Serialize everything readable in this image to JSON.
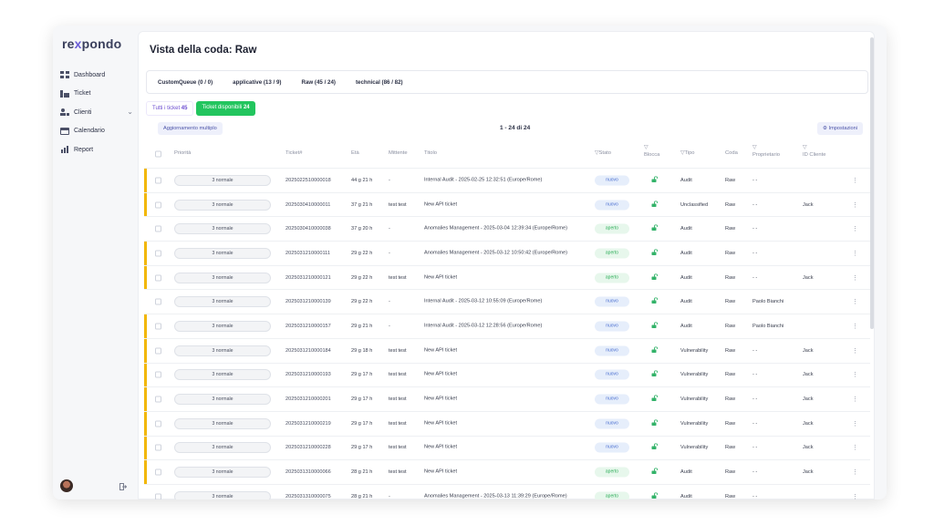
{
  "brand": {
    "name_pre": "re",
    "name_x": "x",
    "name_post": "pondo"
  },
  "sidebar": {
    "items": [
      {
        "label": "Dashboard",
        "icon": "dashboard-icon"
      },
      {
        "label": "Ticket",
        "icon": "ticket-icon"
      },
      {
        "label": "Clienti",
        "icon": "users-icon",
        "chevron": "⌄"
      },
      {
        "label": "Calendario",
        "icon": "calendar-icon"
      },
      {
        "label": "Report",
        "icon": "report-icon"
      }
    ],
    "logout_icon": "logout-icon"
  },
  "page": {
    "title": "Vista della coda: Raw"
  },
  "queue_tabs": [
    "CustomQueue (0 / 0)",
    "applicative (13 / 9)",
    "Raw (45 / 24)",
    "technical (86 / 82)"
  ],
  "filters": {
    "all_label": "Tutti i ticket",
    "all_count": "45",
    "available_label": "Ticket disponibili",
    "available_count": "24"
  },
  "toolbar": {
    "bulk_update": "Aggiornamento multiplo",
    "pagination": "1 - 24 di 24",
    "settings": "Impostazioni"
  },
  "table": {
    "headers": {
      "priorita": "Priorità",
      "ticket": "Ticket#",
      "eta": "Età",
      "mittente": "Mittente",
      "titolo": "Titolo",
      "stato": "Stato",
      "blocca": "Blocca",
      "tipo": "Tipo",
      "coda": "Coda",
      "proprietario": "Proprietario",
      "id_cliente": "ID Cliente"
    },
    "rows": [
      {
        "flag": true,
        "prio": "3 normale",
        "ticket": "2025022510000018",
        "eta": "44 g 21 h",
        "mitt": "-",
        "titolo": "Internal Audit - 2025-02-25 12:32:51 (Europe/Rome)",
        "stato": "nuovo",
        "tipo": "Audit",
        "coda": "Raw",
        "prop": "- -",
        "idc": ""
      },
      {
        "flag": true,
        "prio": "3 normale",
        "ticket": "2025030410000011",
        "eta": "37 g 21 h",
        "mitt": "test test",
        "titolo": "New API ticket",
        "stato": "nuovo",
        "tipo": "Unclassified",
        "coda": "Raw",
        "prop": "- -",
        "idc": "Jack"
      },
      {
        "flag": false,
        "prio": "3 normale",
        "ticket": "2025030410000038",
        "eta": "37 g 20 h",
        "mitt": "-",
        "titolo": "Anomalies Management - 2025-03-04 12:39:34 (Europe/Rome)",
        "stato": "aperto",
        "tipo": "Audit",
        "coda": "Raw",
        "prop": "- -",
        "idc": ""
      },
      {
        "flag": true,
        "prio": "3 normale",
        "ticket": "2025031210000111",
        "eta": "29 g 22 h",
        "mitt": "-",
        "titolo": "Anomalies Management - 2025-03-12 10:50:42 (Europe/Rome)",
        "stato": "aperto",
        "tipo": "Audit",
        "coda": "Raw",
        "prop": "- -",
        "idc": ""
      },
      {
        "flag": true,
        "prio": "3 normale",
        "ticket": "2025031210000121",
        "eta": "29 g 22 h",
        "mitt": "test test",
        "titolo": "New API ticket",
        "stato": "aperto",
        "tipo": "Audit",
        "coda": "Raw",
        "prop": "- -",
        "idc": "Jack"
      },
      {
        "flag": false,
        "prio": "3 normale",
        "ticket": "2025031210000139",
        "eta": "29 g 22 h",
        "mitt": "-",
        "titolo": "Internal Audit - 2025-03-12 10:55:09 (Europe/Rome)",
        "stato": "nuovo",
        "tipo": "Audit",
        "coda": "Raw",
        "prop": "Paolo Bianchi",
        "idc": ""
      },
      {
        "flag": true,
        "prio": "3 normale",
        "ticket": "2025031210000157",
        "eta": "29 g 21 h",
        "mitt": "-",
        "titolo": "Internal Audit - 2025-03-12 12:28:56 (Europe/Rome)",
        "stato": "nuovo",
        "tipo": "Audit",
        "coda": "Raw",
        "prop": "Paolo Bianchi",
        "idc": ""
      },
      {
        "flag": true,
        "prio": "3 normale",
        "ticket": "2025031210000184",
        "eta": "29 g 18 h",
        "mitt": "test test",
        "titolo": "New API ticket",
        "stato": "nuovo",
        "tipo": "Vulnerability",
        "coda": "Raw",
        "prop": "- -",
        "idc": "Jack"
      },
      {
        "flag": true,
        "prio": "3 normale",
        "ticket": "2025031210000193",
        "eta": "29 g 17 h",
        "mitt": "test test",
        "titolo": "New API ticket",
        "stato": "nuovo",
        "tipo": "Vulnerability",
        "coda": "Raw",
        "prop": "- -",
        "idc": "Jack"
      },
      {
        "flag": true,
        "prio": "3 normale",
        "ticket": "2025031210000201",
        "eta": "29 g 17 h",
        "mitt": "test test",
        "titolo": "New API ticket",
        "stato": "nuovo",
        "tipo": "Vulnerability",
        "coda": "Raw",
        "prop": "- -",
        "idc": "Jack"
      },
      {
        "flag": true,
        "prio": "3 normale",
        "ticket": "2025031210000219",
        "eta": "29 g 17 h",
        "mitt": "test test",
        "titolo": "New API ticket",
        "stato": "nuovo",
        "tipo": "Vulnerability",
        "coda": "Raw",
        "prop": "- -",
        "idc": "Jack"
      },
      {
        "flag": true,
        "prio": "3 normale",
        "ticket": "2025031210000228",
        "eta": "29 g 17 h",
        "mitt": "test test",
        "titolo": "New API ticket",
        "stato": "nuovo",
        "tipo": "Vulnerability",
        "coda": "Raw",
        "prop": "- -",
        "idc": "Jack"
      },
      {
        "flag": true,
        "prio": "3 normale",
        "ticket": "2025031310000066",
        "eta": "28 g 21 h",
        "mitt": "test test",
        "titolo": "New API ticket",
        "stato": "aperto",
        "tipo": "Audit",
        "coda": "Raw",
        "prop": "- -",
        "idc": "Jack"
      },
      {
        "flag": false,
        "prio": "3 normale",
        "ticket": "2025031310000075",
        "eta": "28 g 21 h",
        "mitt": "-",
        "titolo": "Anomalies Management - 2025-03-13 11:39:29 (Europe/Rome)",
        "stato": "aperto",
        "tipo": "Audit",
        "coda": "Raw",
        "prop": "- -",
        "idc": ""
      }
    ]
  },
  "colors": {
    "accent": "#22c55e",
    "flag": "#f2b705",
    "brand": "#6a5cd6"
  }
}
